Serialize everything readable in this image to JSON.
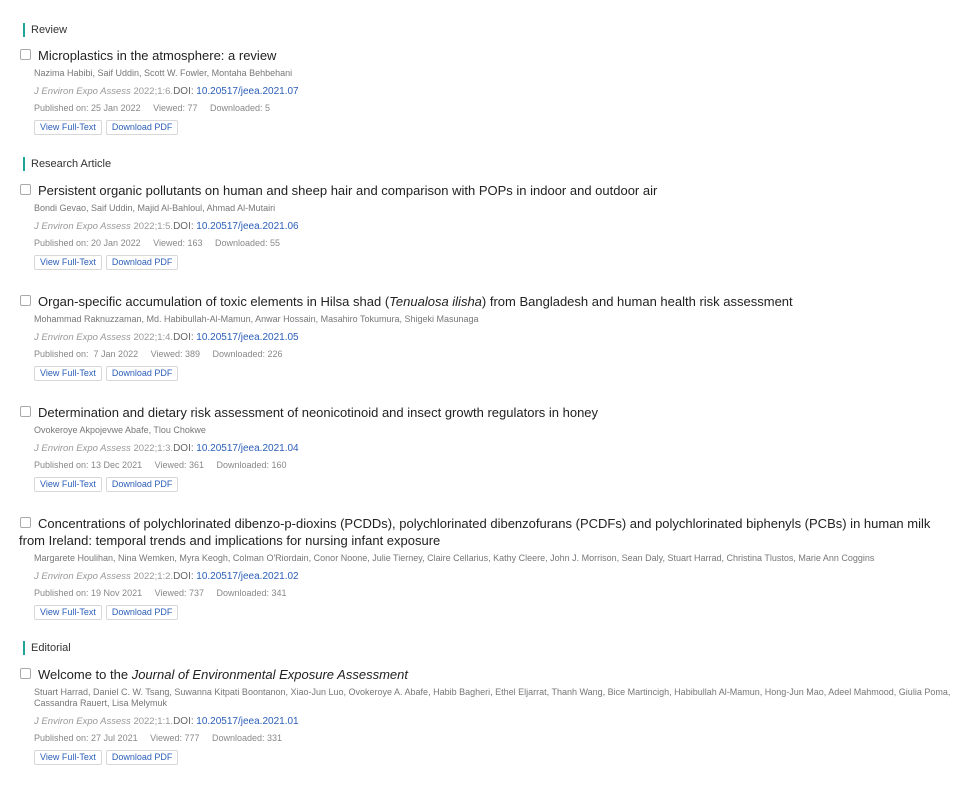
{
  "sections": {
    "review": "Review",
    "research": "Research Article",
    "editorial": "Editorial"
  },
  "buttons": {
    "view": "View Full-Text",
    "download": "Download PDF"
  },
  "articles": [
    {
      "title": "Microplastics in the atmosphere: a review",
      "authors": "Nazima Habibi, Saif Uddin, Scott W. Fowler, Montaha Behbehani",
      "journal": "J Environ Expo Assess",
      "cite": "2022;1:6.",
      "doi_label": "DOI:",
      "doi": "10.20517/jeea.2021.07",
      "published": "Published on: 25 Jan 2022",
      "viewed": "Viewed: 77",
      "downloaded": "Downloaded: 5"
    },
    {
      "title": "Persistent organic pollutants on human and sheep hair and comparison with POPs in indoor and outdoor air",
      "authors": "Bondi Gevao, Saif Uddin, Majid Al-Bahloul, Ahmad Al-Mutairi",
      "journal": "J Environ Expo Assess",
      "cite": "2022;1:5.",
      "doi_label": "DOI:",
      "doi": "10.20517/jeea.2021.06",
      "published": "Published on: 20 Jan 2022",
      "viewed": "Viewed: 163",
      "downloaded": "Downloaded: 55"
    },
    {
      "title_pre": "Organ-specific accumulation of toxic elements in Hilsa shad (",
      "title_italic": "Tenualosa ilisha",
      "title_post": ") from Bangladesh and human health risk assessment",
      "authors": "Mohammad Raknuzzaman, Md. Habibullah-Al-Mamun, Anwar Hossain, Masahiro Tokumura, Shigeki Masunaga",
      "journal": "J Environ Expo Assess",
      "cite": "2022;1:4.",
      "doi_label": "DOI:",
      "doi": "10.20517/jeea.2021.05",
      "published": "Published on:  7 Jan 2022",
      "viewed": "Viewed: 389",
      "downloaded": "Downloaded: 226"
    },
    {
      "title": "Determination and dietary risk assessment of neonicotinoid and insect growth regulators in honey",
      "authors": "Ovokeroye Akpojevwe Abafe, Tlou Chokwe",
      "journal": "J Environ Expo Assess",
      "cite": "2022;1:3.",
      "doi_label": "DOI:",
      "doi": "10.20517/jeea.2021.04",
      "published": "Published on: 13 Dec 2021",
      "viewed": "Viewed: 361",
      "downloaded": "Downloaded: 160"
    },
    {
      "title": "Concentrations of polychlorinated dibenzo-p-dioxins (PCDDs), polychlorinated dibenzofurans (PCDFs) and polychlorinated biphenyls (PCBs) in human milk from Ireland: temporal trends and implications for nursing infant exposure",
      "authors": "Margarete Houlihan, Nina Wemken, Myra Keogh, Colman O'Riordain, Conor Noone, Julie Tierney, Claire Cellarius, Kathy Cleere, John J. Morrison, Sean Daly, Stuart Harrad, Christina Tlustos, Marie Ann Coggins",
      "journal": "J Environ Expo Assess",
      "cite": "2022;1:2.",
      "doi_label": "DOI:",
      "doi": "10.20517/jeea.2021.02",
      "published": "Published on: 19 Nov 2021",
      "viewed": "Viewed: 737",
      "downloaded": "Downloaded: 341"
    },
    {
      "title_pre": "Welcome to the ",
      "title_italic": "Journal of Environmental Exposure Assessment",
      "title_post": "",
      "authors": "Stuart Harrad, Daniel C. W. Tsang, Suwanna Kitpati Boontanon, Xiao-Jun Luo, Ovokeroye A. Abafe, Habib Bagheri, Ethel Eljarrat, Thanh Wang, Bice Martincigh, Habibullah Al-Mamun, Hong-Jun Mao, Adeel Mahmood, Giulia Poma, Cassandra Rauert, Lisa Melymuk",
      "journal": "J Environ Expo Assess",
      "cite": "2022;1:1.",
      "doi_label": "DOI:",
      "doi": "10.20517/jeea.2021.01",
      "published": "Published on: 27 Jul 2021",
      "viewed": "Viewed: 777",
      "downloaded": "Downloaded: 331"
    }
  ]
}
